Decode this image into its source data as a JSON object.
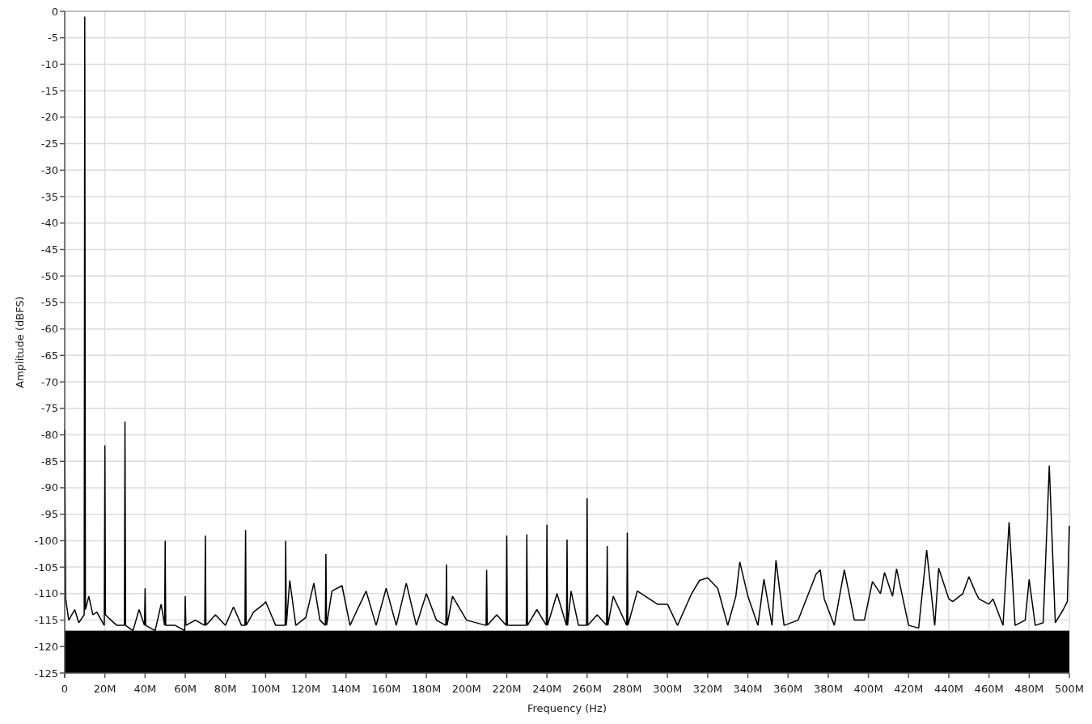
{
  "chart": {
    "chart_data": {
      "type": "line",
      "xlabel": "Frequency (Hz)",
      "ylabel": "Amplitude (dBFS)",
      "x": [
        0,
        500000.0,
        2000000.0,
        5000000.0,
        7000000.0,
        9700000.0,
        10000000.0,
        10300000.0,
        12000000.0,
        14000000.0,
        16000000.0,
        19700000.0,
        20000000.0,
        20300000.0,
        23000000.0,
        26000000.0,
        29700000.0,
        30000000.0,
        30300000.0,
        34000000.0,
        37000000.0,
        39700000.0,
        40000000.0,
        40300000.0,
        45000000.0,
        48000000.0,
        49700000.0,
        50000000.0,
        50300000.0,
        55000000.0,
        59700000.0,
        60000000.0,
        60300000.0,
        65000000.0,
        69700000.0,
        70000000.0,
        70300000.0,
        75000000.0,
        80000000.0,
        84000000.0,
        88000000.0,
        89700000.0,
        90000000.0,
        90300000.0,
        94000000.0,
        99000000.0,
        100000000.0,
        105000000.0,
        109700000.0,
        110000000.0,
        110300000.0,
        112000000.0,
        115000000.0,
        120000000.0,
        124000000.0,
        127000000.0,
        129700000.0,
        130000000.0,
        130300000.0,
        133000000.0,
        138000000.0,
        142000000.0,
        150000000.0,
        155000000.0,
        160000000.0,
        165000000.0,
        170000000.0,
        175000000.0,
        180000000.0,
        185000000.0,
        189700000.0,
        190000000.0,
        190300000.0,
        193000000.0,
        200000000.0,
        209700000.0,
        210000000.0,
        210300000.0,
        215000000.0,
        219700000.0,
        220000000.0,
        220300000.0,
        229700000.0,
        230000000.0,
        230300000.0,
        235000000.0,
        239700000.0,
        240000000.0,
        240300000.0,
        245000000.0,
        249700000.0,
        250000000.0,
        250300000.0,
        252000000.0,
        255700000.0,
        259700000.0,
        260000000.0,
        260300000.0,
        265000000.0,
        269700000.0,
        270000000.0,
        270300000.0,
        273000000.0,
        279700000.0,
        280000000.0,
        280300000.0,
        285000000.0,
        295000000.0,
        300000000.0,
        305000000.0,
        312000000.0,
        316000000.0,
        320000000.0,
        325000000.0,
        330000000.0,
        334000000.0,
        336000000.0,
        340000000.0,
        345000000.0,
        348000000.0,
        352000000.0,
        354000000.0,
        358000000.0,
        365000000.0,
        374000000.0,
        376000000.0,
        378000000.0,
        383000000.0,
        388000000.0,
        393000000.0,
        398000000.0,
        402000000.0,
        406000000.0,
        408000000.0,
        412000000.0,
        414000000.0,
        420000000.0,
        425000000.0,
        429000000.0,
        433000000.0,
        435000000.0,
        440000000.0,
        442000000.0,
        447000000.0,
        450000000.0,
        453000000.0,
        455000000.0,
        460000000.0,
        462000000.0,
        467000000.0,
        470000000.0,
        473000000.0,
        478000000.0,
        480000000.0,
        483000000.0,
        487000000.0,
        490000000.0,
        493000000.0,
        497000000.0,
        499000000.0,
        500000000.0
      ],
      "series": [
        {
          "color": "#000000",
          "values": [
            -79,
            -111,
            -115,
            -113,
            -115.5,
            -114,
            -1,
            -113,
            -110.5,
            -114,
            -113.5,
            -116,
            -82,
            -114,
            -115,
            -116,
            -116,
            -77.5,
            -116,
            -117,
            -113,
            -116,
            -109,
            -116,
            -117,
            -112,
            -116,
            -100,
            -116,
            -116,
            -117,
            -110.5,
            -116,
            -115,
            -116,
            -99,
            -116,
            -114,
            -116,
            -112.5,
            -116,
            -116,
            -98,
            -116,
            -113.5,
            -112,
            -111.5,
            -116,
            -116,
            -100,
            -116,
            -107.5,
            -116,
            -114.5,
            -108,
            -115,
            -116,
            -102.5,
            -116,
            -109.5,
            -108.5,
            -116,
            -109.5,
            -116,
            -109,
            -116,
            -108,
            -116,
            -110,
            -115,
            -116,
            -104.5,
            -116,
            -110.5,
            -115,
            -116,
            -105.5,
            -116,
            -114,
            -116,
            -99,
            -116,
            -116,
            -98.8,
            -116,
            -113,
            -116,
            -97,
            -116,
            -110,
            -116,
            -99.8,
            -116,
            -109.5,
            -116,
            -116,
            -92,
            -116,
            -114,
            -116,
            -101,
            -116,
            -110.5,
            -116,
            -98.5,
            -116,
            -109.5,
            -112,
            -112,
            -116,
            -110,
            -107.5,
            -107,
            -109,
            -116,
            -110.5,
            -104,
            -110.5,
            -116,
            -107.3,
            -116,
            -103.7,
            -116,
            -115,
            -106.3,
            -105.5,
            -111,
            -116,
            -105.5,
            -115,
            -115,
            -107.7,
            -110,
            -106,
            -110.5,
            -105.3,
            -116,
            -116.5,
            -101.8,
            -116,
            -105.2,
            -111,
            -111.5,
            -110,
            -106.8,
            -109.5,
            -111,
            -112,
            -111,
            -116,
            -96.5,
            -116,
            -115,
            -107.3,
            -116,
            -115.5,
            -85.8,
            -115.5,
            -113,
            -111.5,
            -97.2
          ]
        }
      ],
      "grid": true,
      "xlim": [
        0,
        500000000.0
      ],
      "ylim": [
        -125,
        0
      ],
      "xticks": [
        {
          "value": 0,
          "label": "0"
        },
        {
          "value": 20000000.0,
          "label": "20M"
        },
        {
          "value": 40000000.0,
          "label": "40M"
        },
        {
          "value": 60000000.0,
          "label": "60M"
        },
        {
          "value": 80000000.0,
          "label": "80M"
        },
        {
          "value": 100000000.0,
          "label": "100M"
        },
        {
          "value": 120000000.0,
          "label": "120M"
        },
        {
          "value": 140000000.0,
          "label": "140M"
        },
        {
          "value": 160000000.0,
          "label": "160M"
        },
        {
          "value": 180000000.0,
          "label": "180M"
        },
        {
          "value": 200000000.0,
          "label": "200M"
        },
        {
          "value": 220000000.0,
          "label": "220M"
        },
        {
          "value": 240000000.0,
          "label": "240M"
        },
        {
          "value": 260000000.0,
          "label": "260M"
        },
        {
          "value": 280000000.0,
          "label": "280M"
        },
        {
          "value": 300000000.0,
          "label": "300M"
        },
        {
          "value": 320000000.0,
          "label": "320M"
        },
        {
          "value": 340000000.0,
          "label": "340M"
        },
        {
          "value": 360000000.0,
          "label": "360M"
        },
        {
          "value": 380000000.0,
          "label": "380M"
        },
        {
          "value": 400000000.0,
          "label": "400M"
        },
        {
          "value": 420000000.0,
          "label": "420M"
        },
        {
          "value": 440000000.0,
          "label": "440M"
        },
        {
          "value": 460000000.0,
          "label": "460M"
        },
        {
          "value": 480000000.0,
          "label": "480M"
        },
        {
          "value": 500000000.0,
          "label": "500M"
        }
      ],
      "yticks": [
        0,
        -5,
        -10,
        -15,
        -20,
        -25,
        -30,
        -35,
        -40,
        -45,
        -50,
        -55,
        -60,
        -65,
        -70,
        -75,
        -80,
        -85,
        -90,
        -95,
        -100,
        -105,
        -110,
        -115,
        -120,
        -125
      ]
    }
  }
}
